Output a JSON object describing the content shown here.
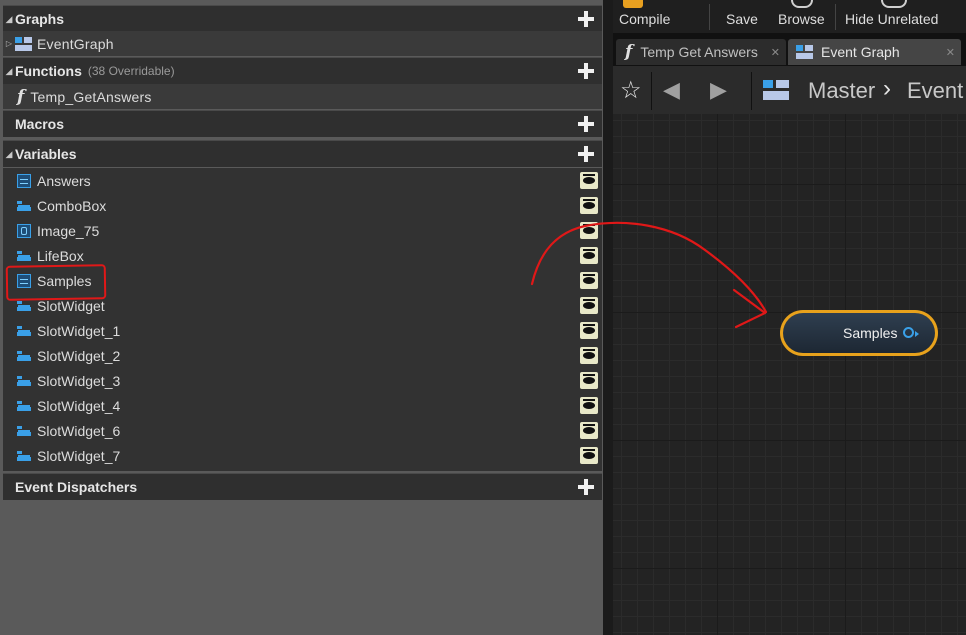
{
  "sections": {
    "graphs": {
      "title": "Graphs"
    },
    "functions": {
      "title": "Functions",
      "count": "(38 Overridable)"
    },
    "macros": {
      "title": "Macros"
    },
    "variables": {
      "title": "Variables"
    },
    "event_dispatchers": {
      "title": "Event Dispatchers"
    }
  },
  "graphs_items": [
    {
      "label": "EventGraph",
      "icon": "event-graph-icon"
    }
  ],
  "functions_items": [
    {
      "label": "Temp_GetAnswers",
      "icon": "function-icon"
    }
  ],
  "variables": [
    {
      "label": "Answers",
      "icon": "widget-box-icon"
    },
    {
      "label": "ComboBox",
      "icon": "widget-stack-icon"
    },
    {
      "label": "Image_75",
      "icon": "image-widget-icon"
    },
    {
      "label": "LifeBox",
      "icon": "widget-stack-icon"
    },
    {
      "label": "Samples",
      "icon": "widget-box-icon"
    },
    {
      "label": "SlotWidget",
      "icon": "widget-stack-icon"
    },
    {
      "label": "SlotWidget_1",
      "icon": "widget-stack-icon"
    },
    {
      "label": "SlotWidget_2",
      "icon": "widget-stack-icon"
    },
    {
      "label": "SlotWidget_3",
      "icon": "widget-stack-icon"
    },
    {
      "label": "SlotWidget_4",
      "icon": "widget-stack-icon"
    },
    {
      "label": "SlotWidget_6",
      "icon": "widget-stack-icon"
    },
    {
      "label": "SlotWidget_7",
      "icon": "widget-stack-icon"
    }
  ],
  "toolbar": {
    "compile": "Compile",
    "save": "Save",
    "browse": "Browse",
    "hide_unrelated": "Hide Unrelated"
  },
  "tabs": [
    {
      "label": "Temp Get Answers",
      "active": false
    },
    {
      "label": "Event Graph",
      "active": true
    }
  ],
  "breadcrumb": {
    "root": "Master",
    "current": "Event"
  },
  "node": {
    "label": "Samples"
  },
  "colors": {
    "node_border": "#e8a21c",
    "pin": "#3aa0e8",
    "annotation": "#e01818",
    "visibility_eye": "#e8e8c8"
  }
}
